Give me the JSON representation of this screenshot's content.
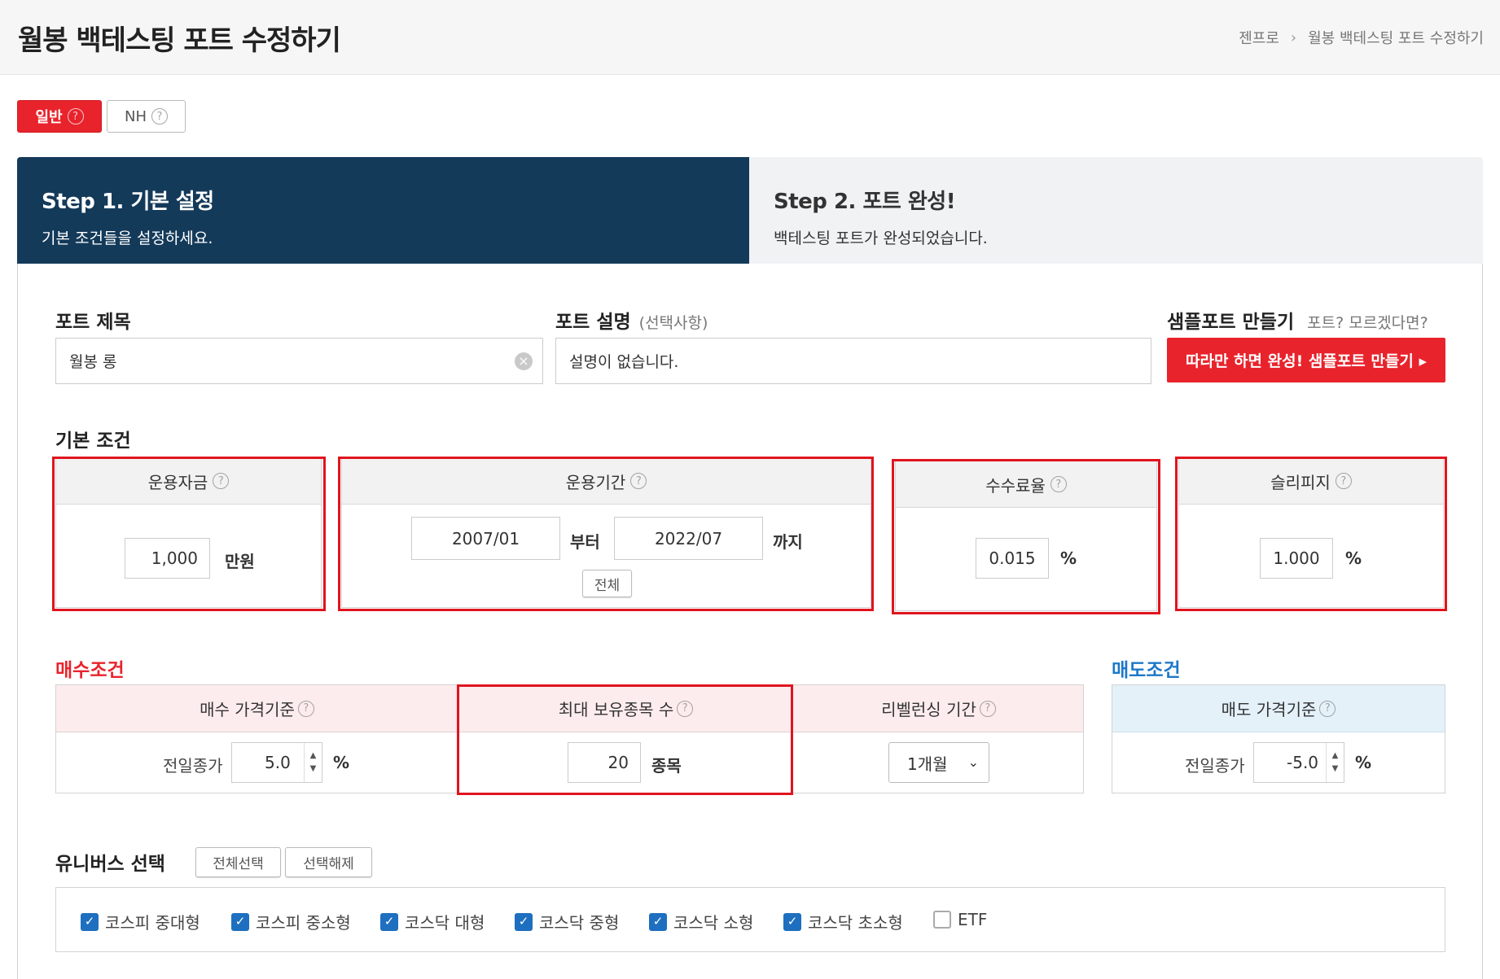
{
  "header": {
    "title": "월봉 백테스팅 포트 수정하기",
    "breadcrumb": [
      "젠프로",
      "월봉 백테스팅 포트 수정하기"
    ]
  },
  "mode_tabs": [
    {
      "label": "일반",
      "active": true
    },
    {
      "label": "NH",
      "active": false
    }
  ],
  "steps": [
    {
      "title": "Step 1. 기본 설정",
      "desc": "기본 조건들을 설정하세요.",
      "active": true
    },
    {
      "title": "Step 2. 포트 완성!",
      "desc": "백테스팅 포트가 완성되었습니다.",
      "active": false
    }
  ],
  "port": {
    "title_label": "포트 제목",
    "title_value": "월봉 롱",
    "desc_label": "포트 설명",
    "desc_optional": "(선택사항)",
    "desc_value": "설명이 없습니다.",
    "sample_label": "샘플포트 만들기",
    "sample_hint": "포트? 모르겠다면?",
    "sample_button": "따라만 하면 완성! 샘플포트 만들기 ▸"
  },
  "basic": {
    "section": "기본 조건",
    "capital": {
      "label": "운용자금",
      "value": "1,000",
      "unit": "만원"
    },
    "period": {
      "label": "운용기간",
      "from": "2007/01",
      "from_suffix": "부터",
      "to": "2022/07",
      "to_suffix": "까지",
      "all_button": "전체"
    },
    "fee": {
      "label": "수수료율",
      "value": "0.015",
      "unit": "%"
    },
    "slippage": {
      "label": "슬리피지",
      "value": "1.000",
      "unit": "%"
    }
  },
  "buy": {
    "section": "매수조건",
    "price_basis": {
      "label": "매수 가격기준",
      "prefix": "전일종가",
      "value": "5.0",
      "unit": "%"
    },
    "max_holdings": {
      "label": "최대 보유종목 수",
      "value": "20",
      "unit": "종목"
    },
    "rebalance": {
      "label": "리벨런싱 기간",
      "value": "1개월"
    }
  },
  "sell": {
    "section": "매도조건",
    "price_basis": {
      "label": "매도 가격기준",
      "prefix": "전일종가",
      "value": "-5.0",
      "unit": "%"
    }
  },
  "universe": {
    "section": "유니버스 선택",
    "select_all": "전체선택",
    "deselect": "선택해제",
    "items": [
      {
        "label": "코스피 중대형",
        "checked": true
      },
      {
        "label": "코스피 중소형",
        "checked": true
      },
      {
        "label": "코스닥 대형",
        "checked": true
      },
      {
        "label": "코스닥 중형",
        "checked": true
      },
      {
        "label": "코스닥 소형",
        "checked": true
      },
      {
        "label": "코스닥 초소형",
        "checked": true
      },
      {
        "label": "ETF",
        "checked": false
      }
    ]
  },
  "colors": {
    "accent_red": "#e8232c",
    "step_active": "#143a5a",
    "sell_blue": "#1d78c8",
    "checkbox_blue": "#1e6fbf"
  }
}
